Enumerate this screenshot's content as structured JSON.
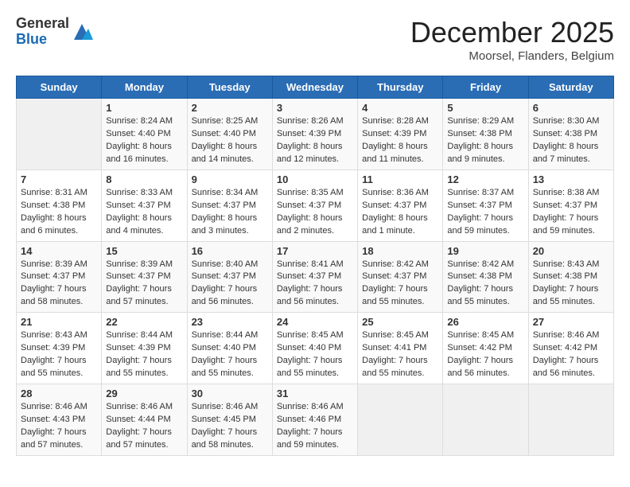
{
  "logo": {
    "general": "General",
    "blue": "Blue"
  },
  "title": "December 2025",
  "location": "Moorsel, Flanders, Belgium",
  "days_of_week": [
    "Sunday",
    "Monday",
    "Tuesday",
    "Wednesday",
    "Thursday",
    "Friday",
    "Saturday"
  ],
  "weeks": [
    [
      {
        "day": "",
        "info": ""
      },
      {
        "day": "1",
        "info": "Sunrise: 8:24 AM\nSunset: 4:40 PM\nDaylight: 8 hours and 16 minutes."
      },
      {
        "day": "2",
        "info": "Sunrise: 8:25 AM\nSunset: 4:40 PM\nDaylight: 8 hours and 14 minutes."
      },
      {
        "day": "3",
        "info": "Sunrise: 8:26 AM\nSunset: 4:39 PM\nDaylight: 8 hours and 12 minutes."
      },
      {
        "day": "4",
        "info": "Sunrise: 8:28 AM\nSunset: 4:39 PM\nDaylight: 8 hours and 11 minutes."
      },
      {
        "day": "5",
        "info": "Sunrise: 8:29 AM\nSunset: 4:38 PM\nDaylight: 8 hours and 9 minutes."
      },
      {
        "day": "6",
        "info": "Sunrise: 8:30 AM\nSunset: 4:38 PM\nDaylight: 8 hours and 7 minutes."
      }
    ],
    [
      {
        "day": "7",
        "info": "Sunrise: 8:31 AM\nSunset: 4:38 PM\nDaylight: 8 hours and 6 minutes."
      },
      {
        "day": "8",
        "info": "Sunrise: 8:33 AM\nSunset: 4:37 PM\nDaylight: 8 hours and 4 minutes."
      },
      {
        "day": "9",
        "info": "Sunrise: 8:34 AM\nSunset: 4:37 PM\nDaylight: 8 hours and 3 minutes."
      },
      {
        "day": "10",
        "info": "Sunrise: 8:35 AM\nSunset: 4:37 PM\nDaylight: 8 hours and 2 minutes."
      },
      {
        "day": "11",
        "info": "Sunrise: 8:36 AM\nSunset: 4:37 PM\nDaylight: 8 hours and 1 minute."
      },
      {
        "day": "12",
        "info": "Sunrise: 8:37 AM\nSunset: 4:37 PM\nDaylight: 7 hours and 59 minutes."
      },
      {
        "day": "13",
        "info": "Sunrise: 8:38 AM\nSunset: 4:37 PM\nDaylight: 7 hours and 59 minutes."
      }
    ],
    [
      {
        "day": "14",
        "info": "Sunrise: 8:39 AM\nSunset: 4:37 PM\nDaylight: 7 hours and 58 minutes."
      },
      {
        "day": "15",
        "info": "Sunrise: 8:39 AM\nSunset: 4:37 PM\nDaylight: 7 hours and 57 minutes."
      },
      {
        "day": "16",
        "info": "Sunrise: 8:40 AM\nSunset: 4:37 PM\nDaylight: 7 hours and 56 minutes."
      },
      {
        "day": "17",
        "info": "Sunrise: 8:41 AM\nSunset: 4:37 PM\nDaylight: 7 hours and 56 minutes."
      },
      {
        "day": "18",
        "info": "Sunrise: 8:42 AM\nSunset: 4:37 PM\nDaylight: 7 hours and 55 minutes."
      },
      {
        "day": "19",
        "info": "Sunrise: 8:42 AM\nSunset: 4:38 PM\nDaylight: 7 hours and 55 minutes."
      },
      {
        "day": "20",
        "info": "Sunrise: 8:43 AM\nSunset: 4:38 PM\nDaylight: 7 hours and 55 minutes."
      }
    ],
    [
      {
        "day": "21",
        "info": "Sunrise: 8:43 AM\nSunset: 4:39 PM\nDaylight: 7 hours and 55 minutes."
      },
      {
        "day": "22",
        "info": "Sunrise: 8:44 AM\nSunset: 4:39 PM\nDaylight: 7 hours and 55 minutes."
      },
      {
        "day": "23",
        "info": "Sunrise: 8:44 AM\nSunset: 4:40 PM\nDaylight: 7 hours and 55 minutes."
      },
      {
        "day": "24",
        "info": "Sunrise: 8:45 AM\nSunset: 4:40 PM\nDaylight: 7 hours and 55 minutes."
      },
      {
        "day": "25",
        "info": "Sunrise: 8:45 AM\nSunset: 4:41 PM\nDaylight: 7 hours and 55 minutes."
      },
      {
        "day": "26",
        "info": "Sunrise: 8:45 AM\nSunset: 4:42 PM\nDaylight: 7 hours and 56 minutes."
      },
      {
        "day": "27",
        "info": "Sunrise: 8:46 AM\nSunset: 4:42 PM\nDaylight: 7 hours and 56 minutes."
      }
    ],
    [
      {
        "day": "28",
        "info": "Sunrise: 8:46 AM\nSunset: 4:43 PM\nDaylight: 7 hours and 57 minutes."
      },
      {
        "day": "29",
        "info": "Sunrise: 8:46 AM\nSunset: 4:44 PM\nDaylight: 7 hours and 57 minutes."
      },
      {
        "day": "30",
        "info": "Sunrise: 8:46 AM\nSunset: 4:45 PM\nDaylight: 7 hours and 58 minutes."
      },
      {
        "day": "31",
        "info": "Sunrise: 8:46 AM\nSunset: 4:46 PM\nDaylight: 7 hours and 59 minutes."
      },
      {
        "day": "",
        "info": ""
      },
      {
        "day": "",
        "info": ""
      },
      {
        "day": "",
        "info": ""
      }
    ]
  ]
}
